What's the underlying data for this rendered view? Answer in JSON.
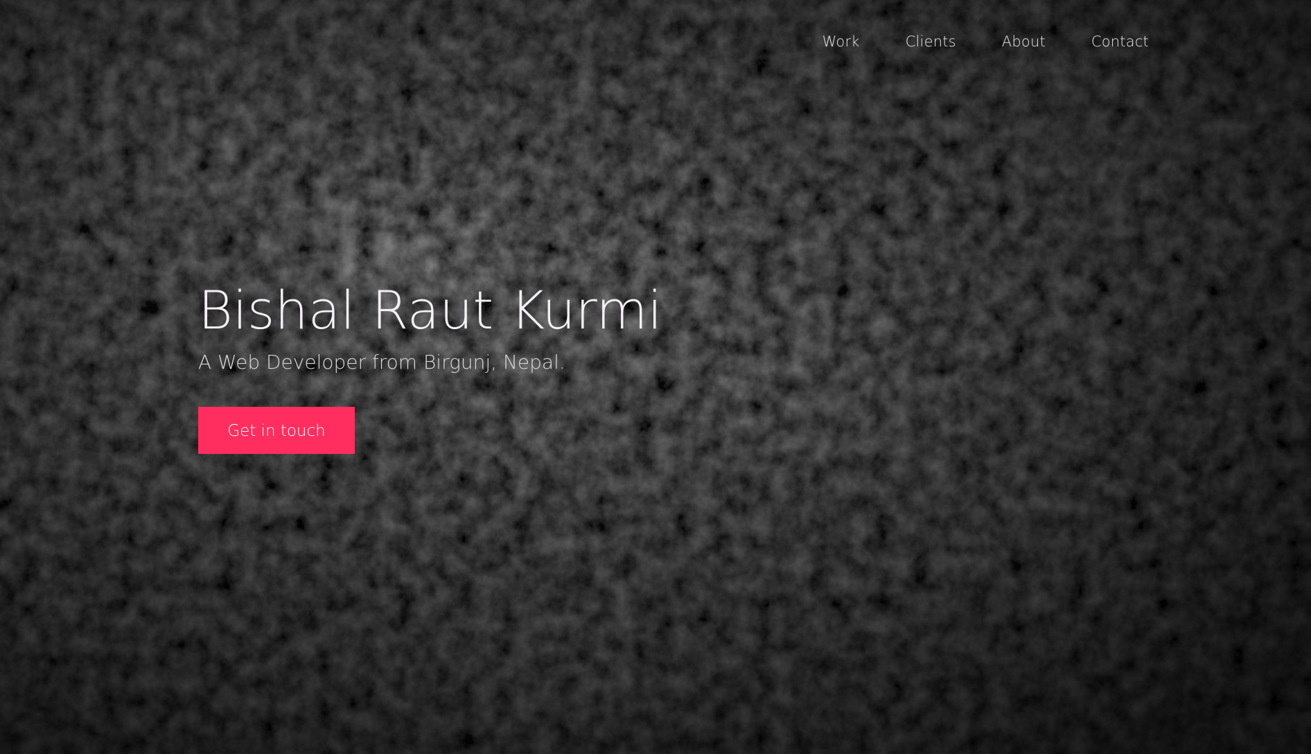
{
  "nav": {
    "items": [
      {
        "label": "Work"
      },
      {
        "label": "Clients"
      },
      {
        "label": "About"
      },
      {
        "label": "Contact"
      }
    ]
  },
  "hero": {
    "title": "Bishal Raut Kurmi",
    "subtitle": "A Web Developer from Birgunj, Nepal.",
    "cta_label": "Get in touch"
  },
  "colors": {
    "accent": "#ff2e5f",
    "background": "#0b0b0b",
    "text": "#f4f0f6"
  }
}
